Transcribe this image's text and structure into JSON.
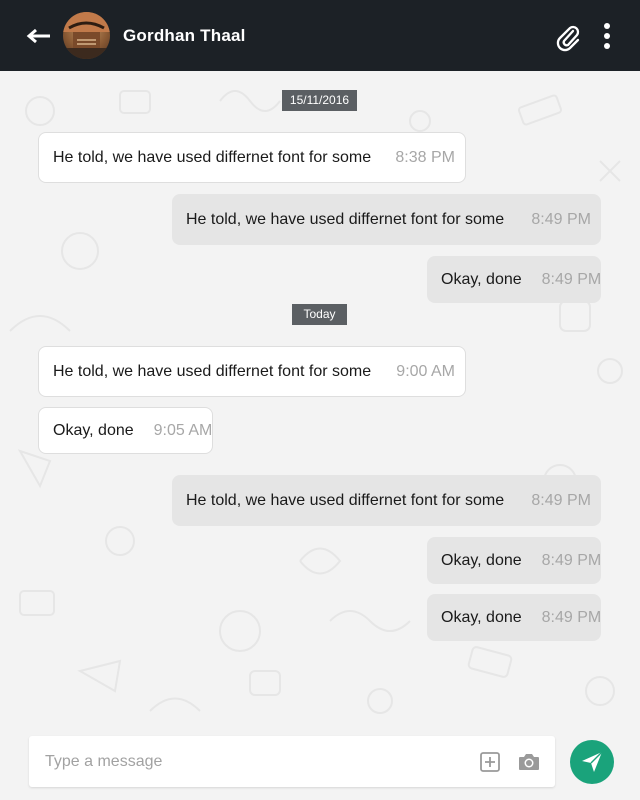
{
  "header": {
    "back_icon": "back-arrow-icon",
    "contact_name": "Gordhan Thaal",
    "attach_icon": "paperclip-icon",
    "menu_icon": "more-vertical-icon",
    "background_color": "#1c2126"
  },
  "chat": {
    "date_separators": [
      "15/11/2016",
      "Today"
    ],
    "messages": [
      {
        "direction": "incoming",
        "text": "He told,  we have used differnet font for some",
        "time": "8:38 PM"
      },
      {
        "direction": "outgoing",
        "text": "He told,  we have used differnet font for some",
        "time": "8:49 PM"
      },
      {
        "direction": "outgoing",
        "text": "Okay, done",
        "time": "8:49 PM"
      },
      {
        "direction": "incoming",
        "text": "He told,  we have used differnet font for some",
        "time": "9:00 AM"
      },
      {
        "direction": "incoming",
        "text": "Okay, done",
        "time": "9:05 AM"
      },
      {
        "direction": "outgoing",
        "text": "He told,  we have used differnet font for some",
        "time": "8:49 PM"
      },
      {
        "direction": "outgoing",
        "text": "Okay, done",
        "time": "8:49 PM"
      },
      {
        "direction": "outgoing",
        "text": "Okay, done",
        "time": "8:49 PM"
      }
    ]
  },
  "composer": {
    "placeholder": "Type a message",
    "value": "",
    "add_icon": "plus-square-icon",
    "camera_icon": "camera-icon",
    "send_icon": "send-icon",
    "send_color": "#1aa37b"
  }
}
